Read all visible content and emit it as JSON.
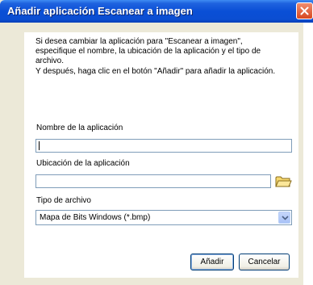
{
  "window": {
    "title": "Añadir aplicación Escanear a imagen"
  },
  "description": {
    "lines": [
      "Si desea cambiar la aplicación para \"Escanear a imagen\",",
      "especifique el nombre, la ubicación de la aplicación y el tipo de",
      "archivo.",
      "Y después, haga clic en el botón \"Añadir\" para añadir la aplicación."
    ]
  },
  "fields": {
    "name_label": "Nombre de la aplicación",
    "name_value": "",
    "location_label": "Ubicación de la aplicación",
    "location_value": "",
    "filetype_label": "Tipo de archivo",
    "filetype_value": "Mapa de Bits Windows (*.bmp)"
  },
  "buttons": {
    "add": "Añadir",
    "cancel": "Cancelar"
  },
  "icons": {
    "close": "close-icon",
    "browse": "folder-icon",
    "dropdown": "chevron-down-icon"
  },
  "colors": {
    "titlebar": "#0a4fd6",
    "close": "#e25a35",
    "dialog_bg": "#ece9d8"
  }
}
